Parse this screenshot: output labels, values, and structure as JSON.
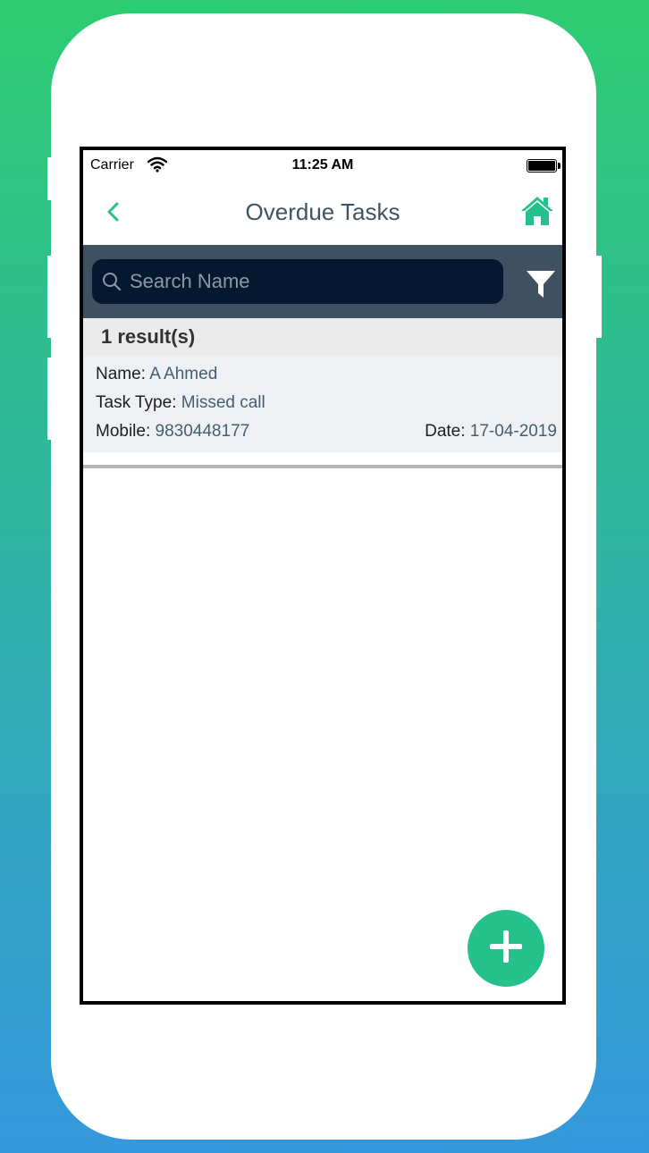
{
  "status_bar": {
    "carrier": "Carrier",
    "time": "11:25 AM"
  },
  "nav": {
    "title": "Overdue Tasks",
    "back_icon": "chevron-left-icon",
    "home_icon": "home-icon"
  },
  "search": {
    "placeholder": "Search Name",
    "value": "",
    "filter_icon": "filter-icon"
  },
  "results": {
    "count_label": "1 result(s)",
    "items": [
      {
        "name_label": "Name:",
        "name": "A Ahmed",
        "type_label": "Task Type:",
        "type": "Missed call",
        "mobile_label": "Mobile:",
        "mobile": "9830448177",
        "date_label": "Date:",
        "date": "17-04-2019"
      }
    ]
  },
  "fab": {
    "icon": "plus-icon"
  },
  "colors": {
    "accent": "#24c18a",
    "search_panel": "#3f5161",
    "search_box": "#041830",
    "title": "#3d5566"
  }
}
